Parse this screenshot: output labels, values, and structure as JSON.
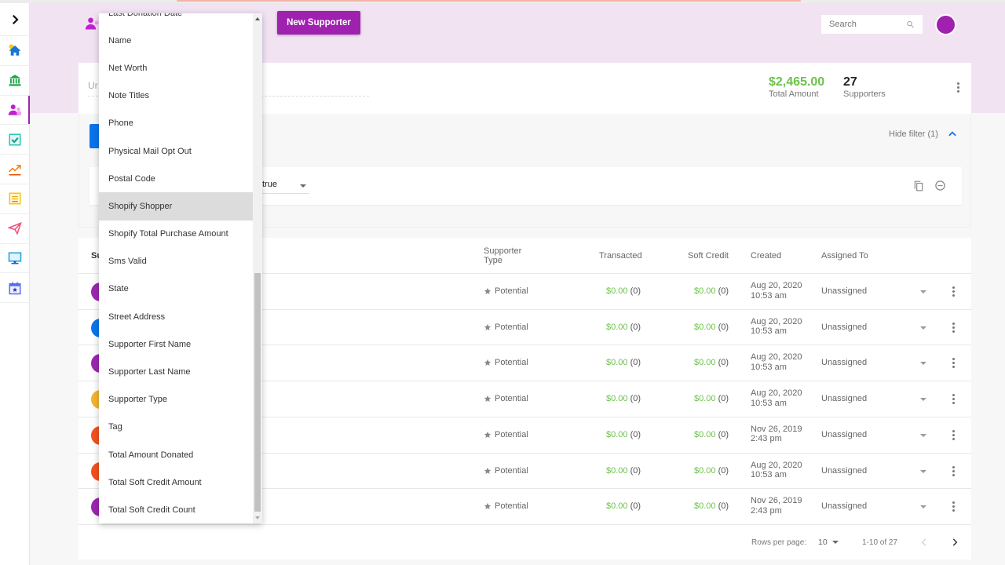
{
  "header": {
    "new_supporter_label": "New Supporter",
    "search_placeholder": "Search",
    "list_name_partial": "Ur"
  },
  "colors": {
    "brand": "#a020b0",
    "money": "#6cc24a",
    "header_bg": "#f2e3f3",
    "primary_blue": "#0a74ec"
  },
  "sidebar": {
    "items": [
      {
        "name": "expand-toggle",
        "icon": "chevron-right-icon"
      },
      {
        "name": "home",
        "icon": "home-icon"
      },
      {
        "name": "bank",
        "icon": "bank-icon"
      },
      {
        "name": "supporters",
        "icon": "users-icon",
        "active": true
      },
      {
        "name": "tasks",
        "icon": "checkbox-icon"
      },
      {
        "name": "reports",
        "icon": "trending-icon"
      },
      {
        "name": "forms",
        "icon": "document-icon"
      },
      {
        "name": "campaigns",
        "icon": "send-icon"
      },
      {
        "name": "website",
        "icon": "monitor-icon"
      },
      {
        "name": "events",
        "icon": "calendar-icon"
      }
    ]
  },
  "summary": {
    "total_amount": "$2,465.00",
    "total_amount_label": "Total Amount",
    "supporters_count": "27",
    "supporters_label": "Supporters"
  },
  "filter": {
    "hide_filter_label": "Hide filter (1)",
    "value": "true"
  },
  "dropdown": {
    "items": [
      "Last Donation Date",
      "Name",
      "Net Worth",
      "Note Titles",
      "Phone",
      "Physical Mail Opt Out",
      "Postal Code",
      "Shopify Shopper",
      "Shopify Total Purchase Amount",
      "Sms Valid",
      "State",
      "Street Address",
      "Supporter First Name",
      "Supporter Last Name",
      "Supporter Type",
      "Tag",
      "Total Amount Donated",
      "Total Soft Credit Amount",
      "Total Soft Credit Count"
    ],
    "highlighted": "Shopify Shopper",
    "scroll_position": 0.52
  },
  "table": {
    "columns": {
      "supporter": "Su",
      "type_line1": "Supporter",
      "type_line2": "Type",
      "transacted": "Transacted",
      "soft_credit": "Soft Credit",
      "created": "Created",
      "assigned": "Assigned To"
    },
    "rows": [
      {
        "avatar_color": "#9c27b0",
        "type": "Potential",
        "transacted": "$0.00",
        "transacted_count": "(0)",
        "soft": "$0.00",
        "soft_count": "(0)",
        "created_date": "Aug 20, 2020",
        "created_time": "10:53 am",
        "assigned": "Unassigned"
      },
      {
        "avatar_color": "#0a74ec",
        "type": "Potential",
        "transacted": "$0.00",
        "transacted_count": "(0)",
        "soft": "$0.00",
        "soft_count": "(0)",
        "created_date": "Aug 20, 2020",
        "created_time": "10:53 am",
        "assigned": "Unassigned"
      },
      {
        "avatar_color": "#9c27b0",
        "type": "Potential",
        "transacted": "$0.00",
        "transacted_count": "(0)",
        "soft": "$0.00",
        "soft_count": "(0)",
        "created_date": "Aug 20, 2020",
        "created_time": "10:53 am",
        "assigned": "Unassigned"
      },
      {
        "avatar_color": "#f2b531",
        "type": "Potential",
        "transacted": "$0.00",
        "transacted_count": "(0)",
        "soft": "$0.00",
        "soft_count": "(0)",
        "created_date": "Aug 20, 2020",
        "created_time": "10:53 am",
        "assigned": "Unassigned"
      },
      {
        "avatar_color": "#f4511e",
        "type": "Potential",
        "transacted": "$0.00",
        "transacted_count": "(0)",
        "soft": "$0.00",
        "soft_count": "(0)",
        "created_date": "Nov 26, 2019",
        "created_time": "2:43 pm",
        "assigned": "Unassigned"
      },
      {
        "avatar_color": "#f4511e",
        "type": "Potential",
        "transacted": "$0.00",
        "transacted_count": "(0)",
        "soft": "$0.00",
        "soft_count": "(0)",
        "created_date": "Aug 20, 2020",
        "created_time": "10:53 am",
        "assigned": "Unassigned"
      },
      {
        "avatar_color": "#9c27b0",
        "type": "Potential",
        "transacted": "$0.00",
        "transacted_count": "(0)",
        "soft": "$0.00",
        "soft_count": "(0)",
        "created_date": "Nov 26, 2019",
        "created_time": "2:43 pm",
        "assigned": "Unassigned"
      }
    ],
    "pagination": {
      "rows_per_page_label": "Rows per page:",
      "rows_per_page": "10",
      "range": "1-10 of 27"
    }
  }
}
